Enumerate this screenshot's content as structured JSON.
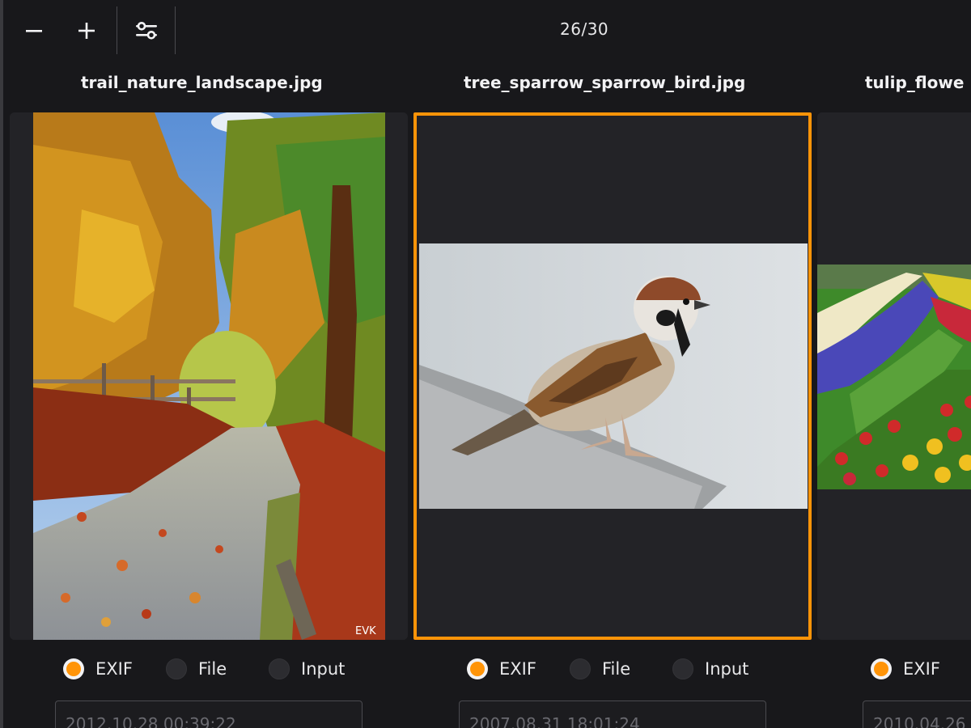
{
  "toolbar": {
    "zoom_out_icon": "minus-icon",
    "zoom_in_icon": "plus-icon",
    "settings_icon": "sliders-icon",
    "counter": "26/30"
  },
  "accent_color": "#ff9408",
  "columns": [
    {
      "filename": "trail_nature_landscape.jpg",
      "image": "autumn forest trail photo",
      "watermark": "EVK",
      "options": [
        "EXIF",
        "File",
        "Input"
      ],
      "selected_option": "EXIF",
      "date": "2012.10.28 00:39:22"
    },
    {
      "filename": "tree_sparrow_sparrow_bird.jpg",
      "image": "tree sparrow on concrete ledge photo",
      "options": [
        "EXIF",
        "File",
        "Input"
      ],
      "selected_option": "EXIF",
      "date": "2007.08.31 18:01:24",
      "selected": true
    },
    {
      "filename": "tulip_flowe",
      "image": "tulip and hyacinth garden photo",
      "options": [
        "EXIF"
      ],
      "selected_option": "EXIF",
      "date": "2010.04.26"
    }
  ]
}
